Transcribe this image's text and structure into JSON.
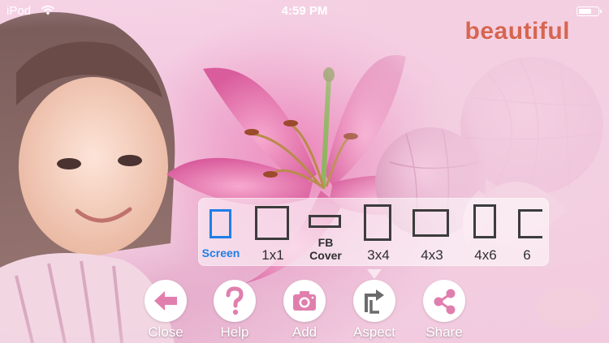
{
  "status_bar": {
    "carrier": "iPod",
    "time": "4:59 PM",
    "battery_level": 0.75
  },
  "logo": {
    "text": "beautiful",
    "color": "#d76550"
  },
  "aspect_panel": {
    "selected_color": "#1f7ee6",
    "options": [
      {
        "id": "screen",
        "label": "Screen",
        "selected": true
      },
      {
        "id": "1x1",
        "label": "1x1"
      },
      {
        "id": "fb-cover",
        "label_line1": "FB",
        "label_line2": "Cover"
      },
      {
        "id": "3x4",
        "label": "3x4"
      },
      {
        "id": "4x3",
        "label": "4x3"
      },
      {
        "id": "4x6",
        "label": "4x6"
      },
      {
        "id": "6",
        "label": "6"
      }
    ]
  },
  "toolbar": {
    "buttons": [
      {
        "id": "close",
        "label": "Close",
        "icon": "back-arrow-icon"
      },
      {
        "id": "help",
        "label": "Help",
        "icon": "question-icon"
      },
      {
        "id": "add",
        "label": "Add",
        "icon": "camera-icon"
      },
      {
        "id": "aspect",
        "label": "Aspect",
        "icon": "aspect-arrow-icon"
      },
      {
        "id": "share",
        "label": "Share",
        "icon": "share-icon"
      }
    ]
  }
}
